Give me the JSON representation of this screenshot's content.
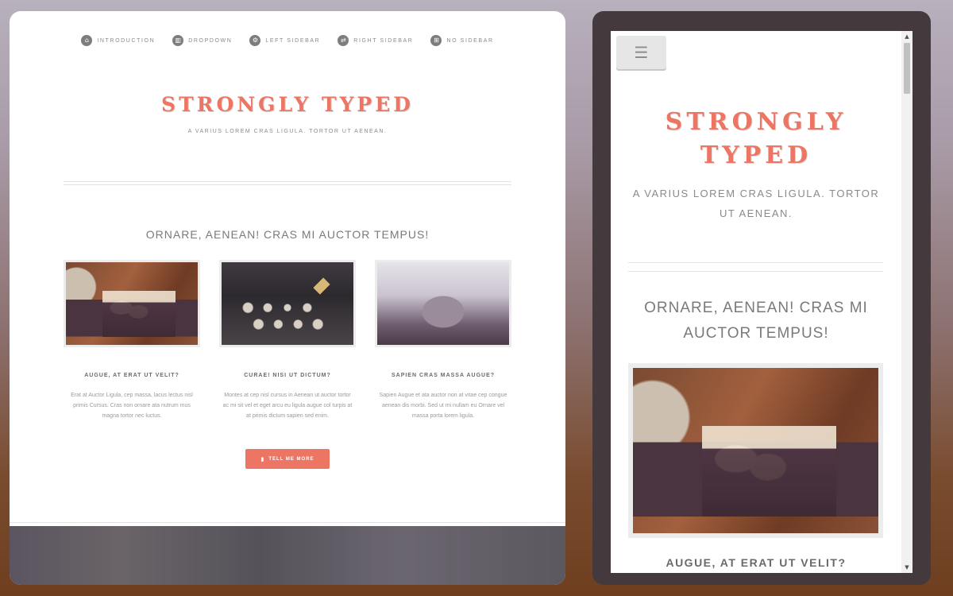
{
  "desktop": {
    "nav": [
      {
        "label": "INTRODUCTION",
        "icon": "home-icon",
        "glyph": "⌂"
      },
      {
        "label": "DROPDOWN",
        "icon": "bar-chart-icon",
        "glyph": "▥"
      },
      {
        "label": "LEFT SIDEBAR",
        "icon": "gear-icon",
        "glyph": "⚙"
      },
      {
        "label": "RIGHT SIDEBAR",
        "icon": "retweet-icon",
        "glyph": "⇄"
      },
      {
        "label": "NO SIDEBAR",
        "icon": "sitemap-icon",
        "glyph": "⊞"
      }
    ],
    "logo": "STRONGLY TYPED",
    "tagline": "A VARIUS LOREM CRAS LIGULA. TORTOR UT AENEAN.",
    "section_title": "ORNARE, AENEAN! CRAS MI AUCTOR TEMPUS!",
    "cards": [
      {
        "title": "AUGUE, AT ERAT UT VELIT?",
        "text": "Erat at Auctor Ligula, cep massa, lacus lectus nisl primis Cursus. Cras non ornare ata nutrum mus magna tortor nec luctus."
      },
      {
        "title": "CURAE! NISI UT DICTUM?",
        "text": "Montes at cep nisl cursus in Aenean ut auctor tortor ac mi sit vel et eget arcu eu ligula augue col turpis at at primis dictum sapien sed enim."
      },
      {
        "title": "SAPIEN CRAS MASSA AUGUE?",
        "text": "Sapien Augue et ata auctor non at vitae cep congue aenean dis morbi. Sed ut mi nullam eu Ornare vel massa porta lorem ligula."
      }
    ],
    "button": {
      "label": "TELL ME MORE",
      "icon": "document-icon",
      "glyph": "▮"
    }
  },
  "mobile": {
    "menu_glyph": "☰",
    "logo_line1": "STRONGLY",
    "logo_line2": "TYPED",
    "tagline": "A VARIUS LOREM CRAS LIGULA. TORTOR UT AENEAN.",
    "section_title": "ORNARE, AENEAN! CRAS MI AUCTOR TEMPUS!",
    "card_title": "AUGUE, AT ERAT UT VELIT?",
    "scroll_up": "▲",
    "scroll_down": "▼"
  },
  "colors": {
    "accent": "#ec7563",
    "phone_frame": "#44393d",
    "text_muted": "#8a8a8a"
  }
}
